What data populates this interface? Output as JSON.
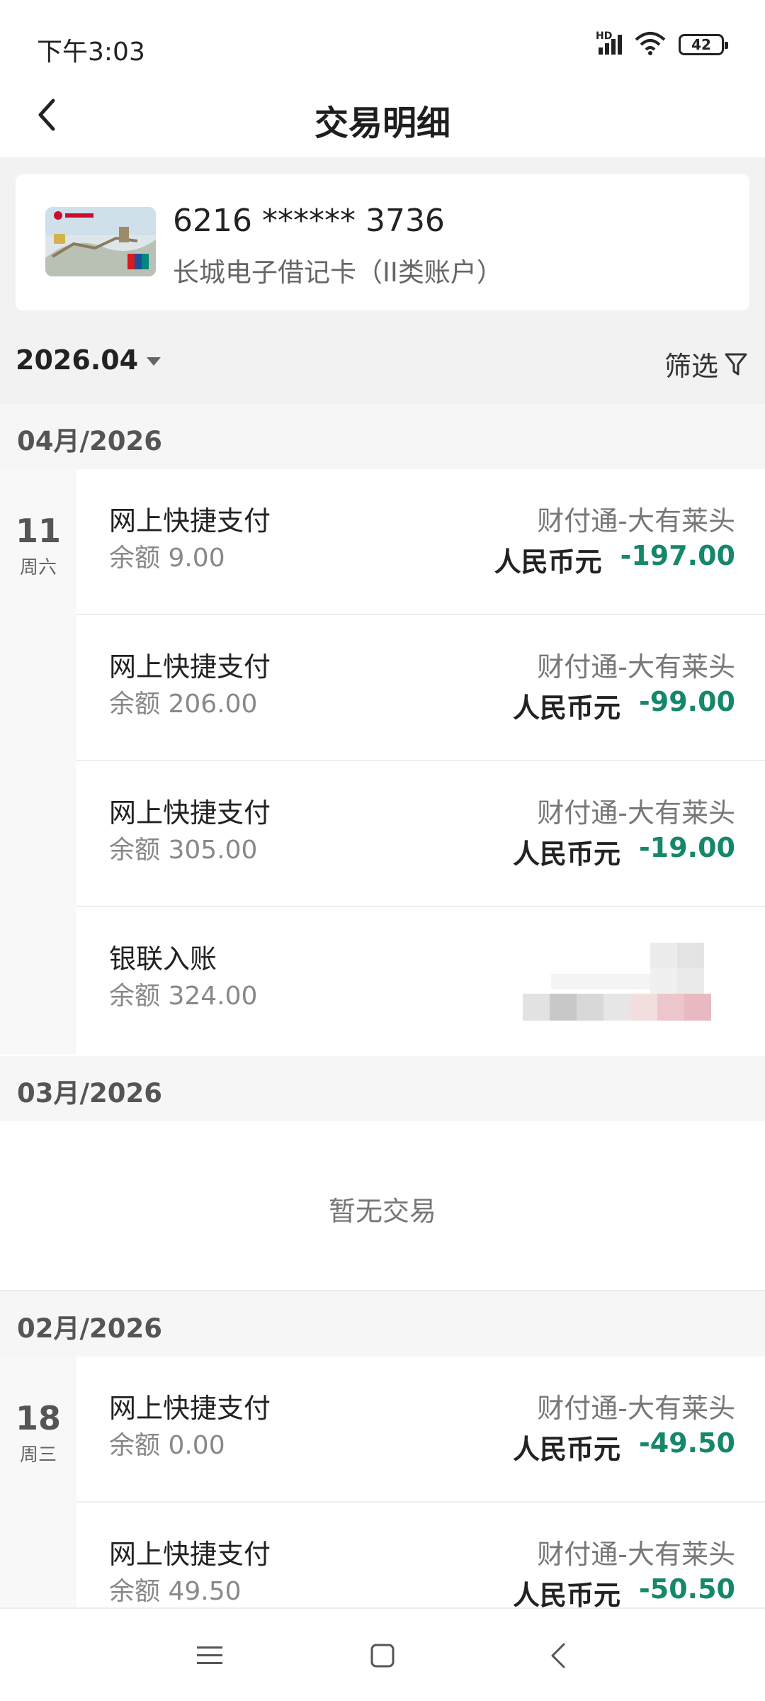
{
  "status_bar": {
    "time": "下午3:03",
    "network": "HD",
    "battery": "42"
  },
  "header": {
    "title": "交易明细",
    "back_icon": "chevron-left-icon"
  },
  "card": {
    "number": "6216 ****** 3736",
    "type": "长城电子借记卡（II类账户）"
  },
  "toolbar": {
    "month": "2026.04",
    "filter_label": "筛选",
    "filter_icon": "filter-icon"
  },
  "sections": [
    {
      "month": "04月/2026",
      "days": [
        {
          "day": "11",
          "weekday": "周六",
          "transactions": [
            {
              "title": "网上快捷支付",
              "balance": "余额 9.00",
              "merchant": "财付通-大有莱头",
              "currency": "人民币元",
              "amount": "-197.00"
            },
            {
              "title": "网上快捷支付",
              "balance": "余额 206.00",
              "merchant": "财付通-大有莱头",
              "currency": "人民币元",
              "amount": "-99.00"
            },
            {
              "title": "网上快捷支付",
              "balance": "余额 305.00",
              "merchant": "财付通-大有莱头",
              "currency": "人民币元",
              "amount": "-19.00"
            },
            {
              "title": "银联入账",
              "balance": "余额 324.00",
              "merchant": "",
              "currency": "",
              "amount": ""
            }
          ]
        }
      ]
    },
    {
      "month": "03月/2026",
      "empty_text": "暂无交易"
    },
    {
      "month": "02月/2026",
      "days": [
        {
          "day": "18",
          "weekday": "周三",
          "transactions": [
            {
              "title": "网上快捷支付",
              "balance": "余额 0.00",
              "merchant": "财付通-大有莱头",
              "currency": "人民币元",
              "amount": "-49.50"
            },
            {
              "title": "网上快捷支付",
              "balance": "余额 49.50",
              "merchant": "财付通-大有莱头",
              "currency": "人民币元",
              "amount": "-50.50"
            }
          ]
        }
      ]
    }
  ],
  "nav": {
    "menu_icon": "menu-icon",
    "home_icon": "home-square-icon",
    "back_icon": "back-triangle-icon"
  },
  "colors": {
    "amount_negative": "#15876a",
    "background_grey": "#f2f2f2"
  }
}
